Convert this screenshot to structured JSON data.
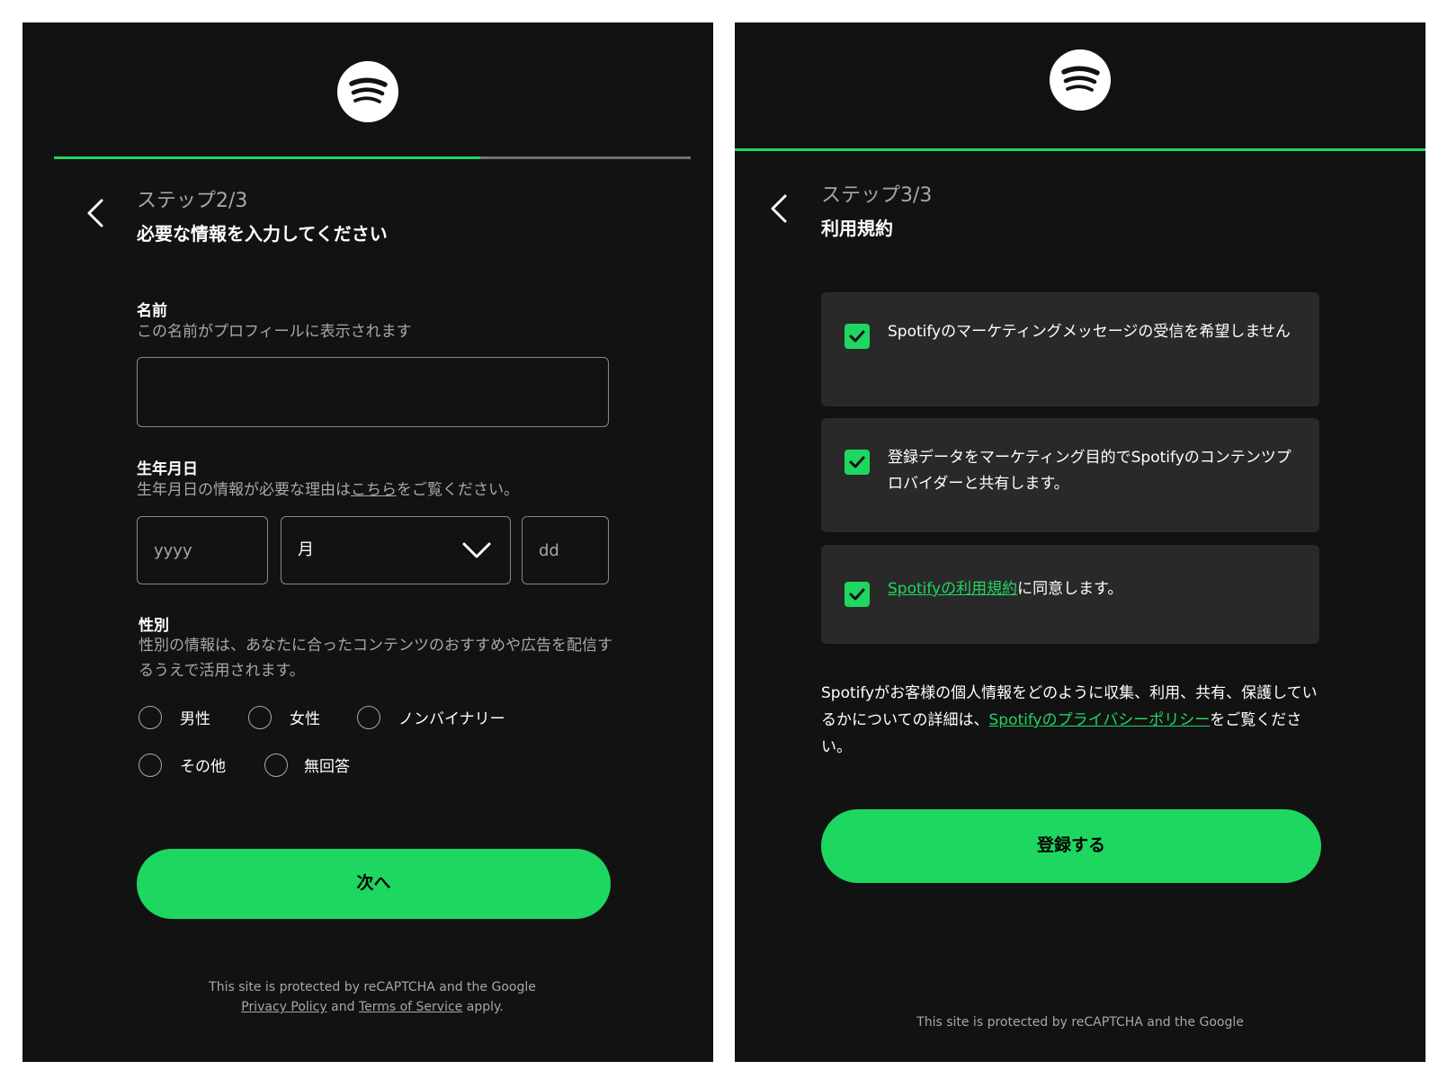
{
  "colors": {
    "background": "#121212",
    "accent": "#1ed760",
    "card": "#292929",
    "muted_text": "#a7a7a7",
    "border": "#878787"
  },
  "left": {
    "logo_icon": "spotify-logo-icon",
    "progress_fraction": 0.67,
    "step_label": "ステップ2/3",
    "heading": "必要な情報を入力してください",
    "name": {
      "label": "名前",
      "hint": "この名前がプロフィールに表示されます",
      "value": "",
      "placeholder": ""
    },
    "birthday": {
      "label": "生年月日",
      "hint_before": "生年月日の情報が必要な理由は",
      "hint_link": "こちら",
      "hint_after": "をご覧ください。",
      "year_placeholder": "yyyy",
      "month_value": "月",
      "day_placeholder": "dd"
    },
    "gender": {
      "label": "性別",
      "hint": "性別の情報は、あなたに合ったコンテンツのおすすめや広告を配信するうえで活用されます。",
      "options": [
        "男性",
        "女性",
        "ノンバイナリー",
        "その他",
        "無回答"
      ]
    },
    "next_button": "次へ",
    "footer": {
      "line1": "This site is protected by reCAPTCHA and the Google",
      "privacy_link": "Privacy Policy",
      "and": "and",
      "terms_link": "Terms of Service",
      "apply": "apply."
    }
  },
  "right": {
    "logo_icon": "spotify-logo-icon",
    "progress_fraction": 1.0,
    "step_label": "ステップ3/3",
    "heading": "利用規約",
    "consents": [
      {
        "checked": true,
        "text": "Spotifyのマーケティングメッセージの受信を希望しません"
      },
      {
        "checked": true,
        "text": "登録データをマーケティング目的でSpotifyのコンテンツプロバイダーと共有します。"
      },
      {
        "checked": true,
        "link": "Spotifyの利用規約",
        "text": "に同意します。"
      }
    ],
    "privacy": {
      "before": "Spotifyがお客様の個人情報をどのように収集、利用、共有、保護しているかについての詳細は、",
      "link": "Spotifyのプライバシーポリシー",
      "after": "をご覧ください。"
    },
    "register_button": "登録する",
    "footer_line1": "This site is protected by reCAPTCHA and the Google"
  }
}
